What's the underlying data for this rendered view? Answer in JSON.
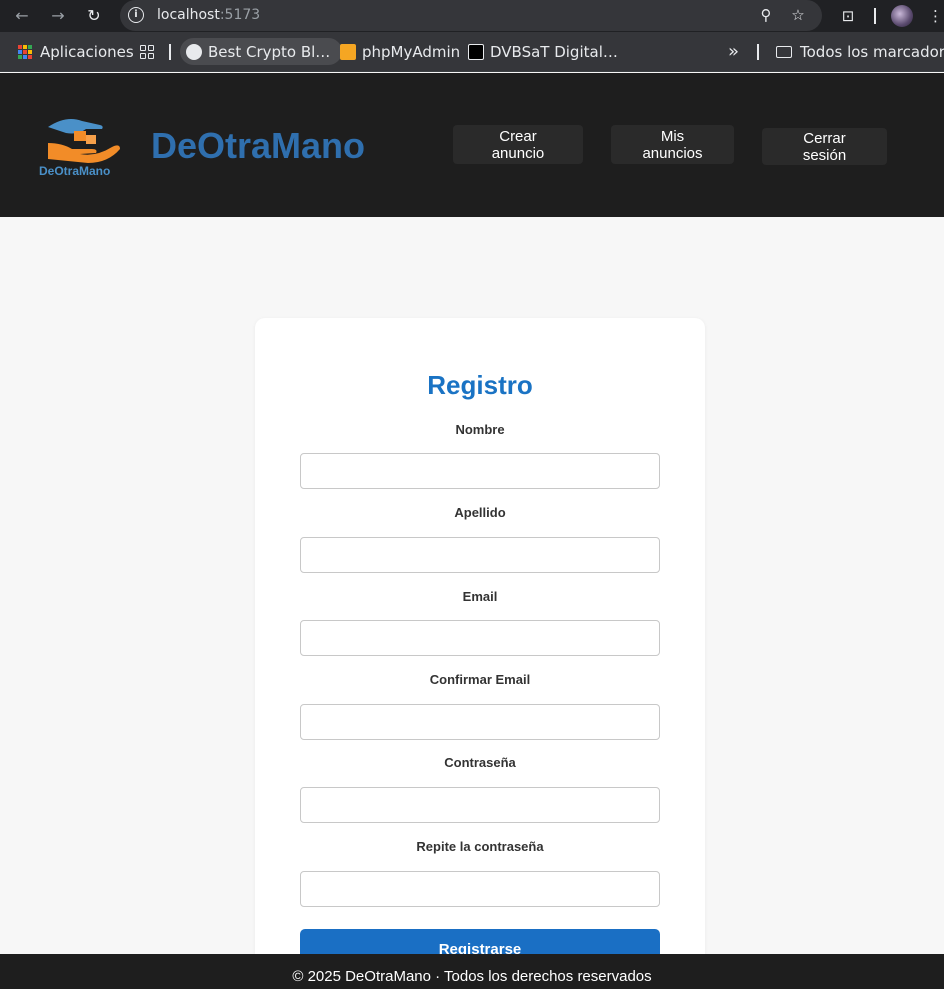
{
  "browser": {
    "url_host": "localhost",
    "url_port": ":5173",
    "bookmarks": {
      "apps_label": "Aplicaciones",
      "item1": "Best Crypto Bl…",
      "item2": "phpMyAdmin",
      "item3": "DVBSaT Digital…",
      "more": "»",
      "all_bookmarks": "Todos los marcadores"
    }
  },
  "header": {
    "brand": "DeOtraMano",
    "logo_text": "DeOtraMano",
    "nav": {
      "create": "Crear anuncio",
      "mine": "Mis anuncios",
      "logout": "Cerrar sesión"
    }
  },
  "form": {
    "title": "Registro",
    "fields": [
      {
        "label": "Nombre",
        "value": ""
      },
      {
        "label": "Apellido",
        "value": ""
      },
      {
        "label": "Email",
        "value": ""
      },
      {
        "label": "Confirmar Email",
        "value": ""
      },
      {
        "label": "Contraseña",
        "value": ""
      },
      {
        "label": "Repite la contraseña",
        "value": ""
      }
    ],
    "submit": "Registrarse"
  },
  "footer": {
    "text": "© 2025 DeOtraMano · Todos los derechos reservados"
  },
  "colors": {
    "brand": "#2f6fae",
    "title": "#1a73c4",
    "primary_button": "#1a6fc4",
    "header_bg": "#1e1e1e"
  }
}
